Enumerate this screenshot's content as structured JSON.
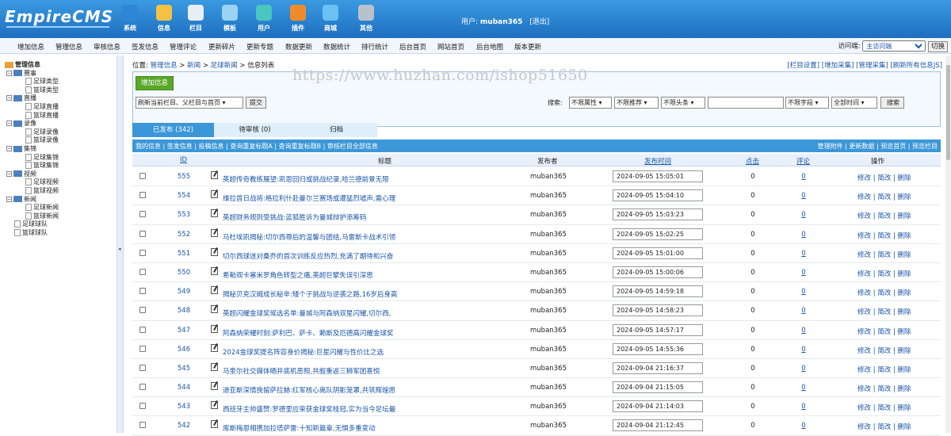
{
  "logo": {
    "text": "EmpireCMS"
  },
  "topnav": [
    {
      "label": "系统",
      "icon": "globe-icon",
      "color": "#2f86d6"
    },
    {
      "label": "信息",
      "icon": "edit-icon",
      "color": "#f4c242"
    },
    {
      "label": "栏目",
      "icon": "folder-icon",
      "color": "#e8eef5"
    },
    {
      "label": "模板",
      "icon": "template-icon",
      "color": "#9ad3f5"
    },
    {
      "label": "用户",
      "icon": "user-icon",
      "color": "#48c6c0"
    },
    {
      "label": "插件",
      "icon": "tools-icon",
      "color": "#f08b2b"
    },
    {
      "label": "商城",
      "icon": "shop-icon",
      "color": "#6ac1f2"
    },
    {
      "label": "其他",
      "icon": "gear-icon",
      "color": "#b8c2cc"
    }
  ],
  "user": {
    "label": "用户:",
    "name": "muban365",
    "logout": "[退出]"
  },
  "menubar": [
    "增加信息",
    "管理信息",
    "审核信息",
    "签发信息",
    "管理评论",
    "更新碎片",
    "更新专题",
    "数据更新",
    "数据统计",
    "排行统计",
    "后台首页",
    "网站首页",
    "后台地图",
    "版本更新"
  ],
  "visit": {
    "label": "访问端:",
    "selected": "主访问端",
    "switch": "切换"
  },
  "sidebar": {
    "root": "管理信息",
    "groups": [
      {
        "name": "赛事",
        "children": [
          "足球类型",
          "篮球类型"
        ]
      },
      {
        "name": "直播",
        "children": [
          "足球直播",
          "篮球直播"
        ]
      },
      {
        "name": "录像",
        "children": [
          "足球录像",
          "篮球录像"
        ]
      },
      {
        "name": "集锦",
        "children": [
          "足球集锦",
          "篮球集锦"
        ]
      },
      {
        "name": "视频",
        "children": [
          "足球视频",
          "篮球视频"
        ]
      },
      {
        "name": "新闻",
        "children": [
          "足球新闻",
          "篮球新闻"
        ]
      }
    ],
    "leaves": [
      "足球球队",
      "篮球球队"
    ]
  },
  "crumb": {
    "prefix": "位置:",
    "path": [
      "管理信息",
      "新闻",
      "足球新闻"
    ],
    "last": "信息列表"
  },
  "toplinks": "[栏目设置] [增加采集] [管理采集] [刷新所有信息JS]",
  "toolbar": {
    "add": "增加信息",
    "refresh_select": "刷新当前栏目、父栏目与首页",
    "submit": "提交",
    "search_label": "搜索:",
    "filters": [
      "不限属性",
      "不限推荐",
      "不限头条"
    ],
    "field": "不限字段",
    "time": "全部时间",
    "search_btn": "搜索"
  },
  "watermark": "https://www.huzhan.com/ishop51650",
  "tabs": [
    "已发布 (342)",
    "待审核 (0)",
    "归档"
  ],
  "tablebar": {
    "left": "我的信息 | 签发信息 | 投稿信息 | 查询重复标题A | 查询重复标题B | 审核栏目全部信息",
    "right": "管理附件 | 更新数据 | 预览首页 | 预览栏目"
  },
  "columns": {
    "id": "ID",
    "title": "标题",
    "publisher": "发布者",
    "time": "发布时间",
    "clicks": "点击",
    "comments": "评论",
    "ops": "操作"
  },
  "rows": [
    {
      "id": "555",
      "title": "英超传奇教练展望:凯恩回归或挑战纪录,哈兰德前景无限",
      "pub": "muban365",
      "time": "2024-09-05 15:05:01",
      "clicks": "0",
      "comments": "0"
    },
    {
      "id": "554",
      "title": "维拉首日战将:格拉利什赴曼尔兰赛场或遭猛烈嘘声,需心理",
      "pub": "muban365",
      "time": "2024-09-05 15:04:10",
      "clicks": "0",
      "comments": "0"
    },
    {
      "id": "553",
      "title": "英超财务规则受挑战:蓝狐胜诉为曼城辩护添筹码",
      "pub": "muban365",
      "time": "2024-09-05 15:03:23",
      "clicks": "0",
      "comments": "0"
    },
    {
      "id": "552",
      "title": "马杜埃凯揭秘:切尔西尊后的温馨与团结,马雷斯卡战术引领",
      "pub": "muban365",
      "time": "2024-09-05 15:02:25",
      "clicks": "0",
      "comments": "0"
    },
    {
      "id": "551",
      "title": "切尔西球迷对桑乔的首次训练反应热烈,充满了期待和兴奋",
      "pub": "muban365",
      "time": "2024-09-05 15:01:00",
      "clicks": "0",
      "comments": "0"
    },
    {
      "id": "550",
      "title": "希勒观卡塞米罗角色转型之痛,英超巨擘失误引深思",
      "pub": "muban365",
      "time": "2024-09-05 15:00:06",
      "clicks": "0",
      "comments": "0"
    },
    {
      "id": "549",
      "title": "揭秘贝克汉姆成长秘辛:矮个子挑战与逆袭之路,16岁后身高",
      "pub": "muban365",
      "time": "2024-09-05 14:59:18",
      "clicks": "0",
      "comments": "0"
    },
    {
      "id": "548",
      "title": "英超闪耀金球奖候选名单:曼城与阿森纳双星闪耀,切尔西,",
      "pub": "muban365",
      "time": "2024-09-05 14:58:23",
      "clicks": "0",
      "comments": "0"
    },
    {
      "id": "547",
      "title": "阿森纳荣耀时刻:萨利巴、萨卡、赖斯及厄德高闪耀金球奖",
      "pub": "muban365",
      "time": "2024-09-05 14:57:17",
      "clicks": "0",
      "comments": "0"
    },
    {
      "id": "546",
      "title": "2024金球奖提名阵容身价揭秘:巨星闪耀与性价比之选",
      "pub": "muban365",
      "time": "2024-09-05 14:55:36",
      "clicks": "0",
      "comments": "0"
    },
    {
      "id": "545",
      "title": "马奎尔社交媒体晒井底机恶照,共叙重返三狮军团喜悦",
      "pub": "muban365",
      "time": "2024-09-04 21:16:37",
      "clicks": "0",
      "comments": "0"
    },
    {
      "id": "544",
      "title": "迪亚斯深情挽留萨拉赫:红军核心离队阴影笼罩,共筑辉煌愿",
      "pub": "muban365",
      "time": "2024-09-04 21:15:05",
      "clicks": "0",
      "comments": "0"
    },
    {
      "id": "543",
      "title": "西班牙主帅盛赞:罗德里应荣获金球奖桂冠,实为当今足坛最",
      "pub": "muban365",
      "time": "2024-09-04 21:14:03",
      "clicks": "0",
      "comments": "0"
    },
    {
      "id": "542",
      "title": "库斯梅恩相携加拉塔萨雷:十知新篇章,无惧多重变动",
      "pub": "muban365",
      "time": "2024-09-04 21:12:45",
      "clicks": "0",
      "comments": "0"
    }
  ],
  "row_ops": "修改 | 简改 | 删除"
}
